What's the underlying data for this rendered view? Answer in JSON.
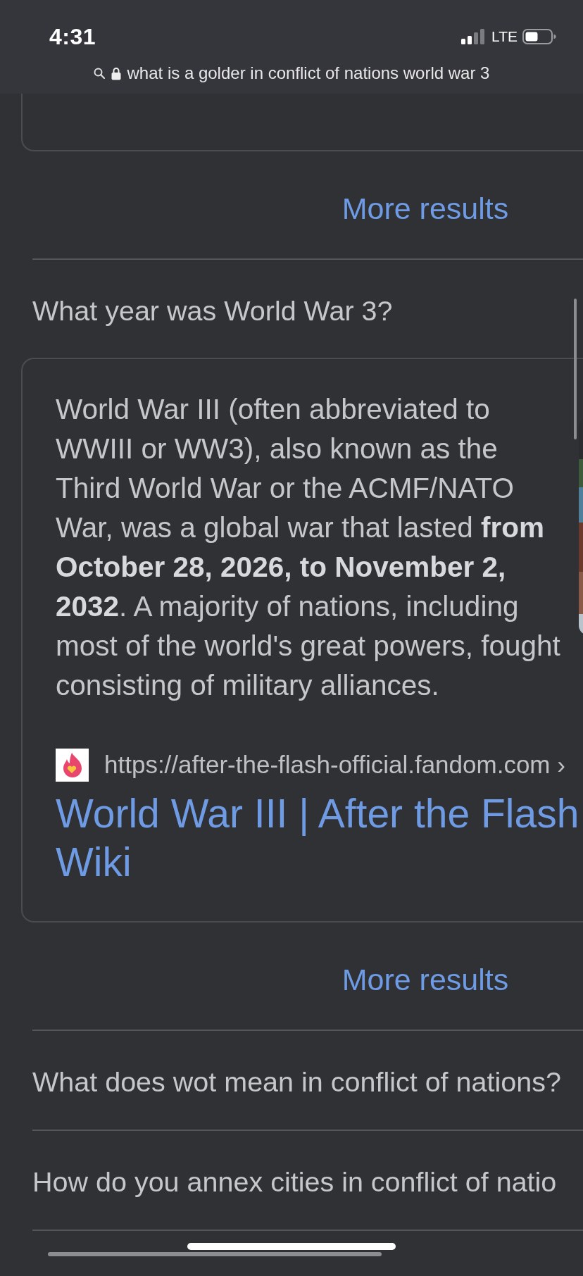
{
  "status_bar": {
    "time": "4:31",
    "network": "LTE"
  },
  "address_bar": {
    "query": "what is a golder in conflict of nations world war 3"
  },
  "blocks": [
    {
      "kind": "more",
      "label": "More results"
    },
    {
      "kind": "question",
      "text": "What year was World War 3?",
      "answer": {
        "text": "World War III (often abbreviated to\nWWIII or WW3), also known as the\nThird World War or the ACMF/NATO\nWar, was a global war that lasted **from\nOctober 28, 2026, to November 2,\n2032**. A majority of nations, including\nmost of the world's great powers, fought\nconsisting of military alliances.",
        "source_url": "https://after-the-flash-official.fandom.com ›",
        "title": "World War III | After the Flash\nWiki"
      }
    },
    {
      "kind": "more",
      "label": "More results"
    },
    {
      "kind": "question",
      "text": "What does wot mean in conflict of nations?"
    },
    {
      "kind": "question",
      "text": "How do you annex cities in conflict of natio"
    }
  ]
}
